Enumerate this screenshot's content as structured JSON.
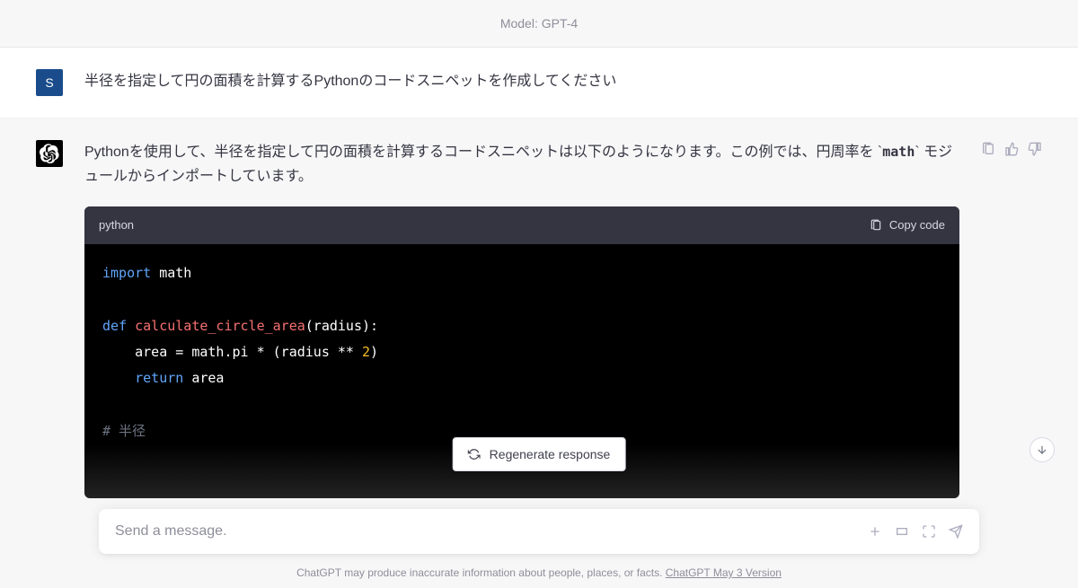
{
  "header": {
    "model_label": "Model: GPT-4"
  },
  "user": {
    "avatar_letter": "S",
    "message": "半径を指定して円の面積を計算するPythonのコードスニペットを作成してください"
  },
  "assistant": {
    "intro_pre": "Pythonを使用して、半径を指定して円の面積を計算するコードスニペットは以下のようになります。この例では、円周率を `",
    "intro_code": "math",
    "intro_post": "` モジュールからインポートしています。",
    "code": {
      "language": "python",
      "copy_label": "Copy code",
      "tokens": {
        "import_kw": "import",
        "import_mod": "math",
        "def_kw": "def",
        "fn_name": "calculate_circle_area",
        "fn_sig_open": "(radius):",
        "body_line": "    area = math.pi * (radius ** ",
        "num_two": "2",
        "body_close": ")",
        "return_kw": "return",
        "return_var": " area",
        "comment_partial": "# 半径"
      }
    }
  },
  "controls": {
    "regenerate_label": "Regenerate response",
    "input_placeholder": "Send a message."
  },
  "footer": {
    "disclaimer": "ChatGPT may produce inaccurate information about people, places, or facts. ",
    "version_link": "ChatGPT May 3 Version"
  }
}
